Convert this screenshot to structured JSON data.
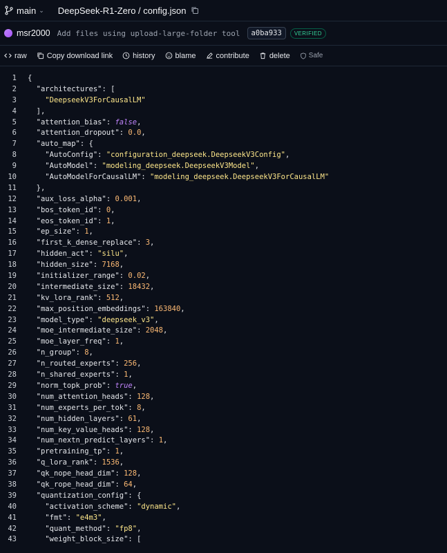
{
  "header": {
    "branch": "main",
    "path": "DeepSeek-R1-Zero / config.json"
  },
  "commit": {
    "author": "msr2000",
    "message": "Add files using upload-large-folder tool",
    "hash": "a0ba933",
    "badge": "VERIFIED"
  },
  "toolbar": {
    "raw": "raw",
    "copy": "Copy download link",
    "history": "history",
    "blame": "blame",
    "contribute": "contribute",
    "delete": "delete",
    "safe": "Safe"
  },
  "colors": {
    "string": "#fde68a",
    "number": "#fdba74",
    "boolean": "#c084fc",
    "verified": "#34d399"
  },
  "code_lines": [
    [
      [
        "p",
        "{"
      ]
    ],
    [
      [
        "p",
        "  "
      ],
      [
        "k",
        "\"architectures\""
      ],
      [
        "p",
        ": ["
      ]
    ],
    [
      [
        "p",
        "    "
      ],
      [
        "s",
        "\"DeepseekV3ForCausalLM\""
      ]
    ],
    [
      [
        "p",
        "  ],"
      ]
    ],
    [
      [
        "p",
        "  "
      ],
      [
        "k",
        "\"attention_bias\""
      ],
      [
        "p",
        ": "
      ],
      [
        "b",
        "false"
      ],
      [
        "p",
        ","
      ]
    ],
    [
      [
        "p",
        "  "
      ],
      [
        "k",
        "\"attention_dropout\""
      ],
      [
        "p",
        ": "
      ],
      [
        "n",
        "0.0"
      ],
      [
        "p",
        ","
      ]
    ],
    [
      [
        "p",
        "  "
      ],
      [
        "k",
        "\"auto_map\""
      ],
      [
        "p",
        ": {"
      ]
    ],
    [
      [
        "p",
        "    "
      ],
      [
        "k",
        "\"AutoConfig\""
      ],
      [
        "p",
        ": "
      ],
      [
        "s",
        "\"configuration_deepseek.DeepseekV3Config\""
      ],
      [
        "p",
        ","
      ]
    ],
    [
      [
        "p",
        "    "
      ],
      [
        "k",
        "\"AutoModel\""
      ],
      [
        "p",
        ": "
      ],
      [
        "s",
        "\"modeling_deepseek.DeepseekV3Model\""
      ],
      [
        "p",
        ","
      ]
    ],
    [
      [
        "p",
        "    "
      ],
      [
        "k",
        "\"AutoModelForCausalLM\""
      ],
      [
        "p",
        ": "
      ],
      [
        "s",
        "\"modeling_deepseek.DeepseekV3ForCausalLM\""
      ]
    ],
    [
      [
        "p",
        "  },"
      ]
    ],
    [
      [
        "p",
        "  "
      ],
      [
        "k",
        "\"aux_loss_alpha\""
      ],
      [
        "p",
        ": "
      ],
      [
        "n",
        "0.001"
      ],
      [
        "p",
        ","
      ]
    ],
    [
      [
        "p",
        "  "
      ],
      [
        "k",
        "\"bos_token_id\""
      ],
      [
        "p",
        ": "
      ],
      [
        "n",
        "0"
      ],
      [
        "p",
        ","
      ]
    ],
    [
      [
        "p",
        "  "
      ],
      [
        "k",
        "\"eos_token_id\""
      ],
      [
        "p",
        ": "
      ],
      [
        "n",
        "1"
      ],
      [
        "p",
        ","
      ]
    ],
    [
      [
        "p",
        "  "
      ],
      [
        "k",
        "\"ep_size\""
      ],
      [
        "p",
        ": "
      ],
      [
        "n",
        "1"
      ],
      [
        "p",
        ","
      ]
    ],
    [
      [
        "p",
        "  "
      ],
      [
        "k",
        "\"first_k_dense_replace\""
      ],
      [
        "p",
        ": "
      ],
      [
        "n",
        "3"
      ],
      [
        "p",
        ","
      ]
    ],
    [
      [
        "p",
        "  "
      ],
      [
        "k",
        "\"hidden_act\""
      ],
      [
        "p",
        ": "
      ],
      [
        "s",
        "\"silu\""
      ],
      [
        "p",
        ","
      ]
    ],
    [
      [
        "p",
        "  "
      ],
      [
        "k",
        "\"hidden_size\""
      ],
      [
        "p",
        ": "
      ],
      [
        "n",
        "7168"
      ],
      [
        "p",
        ","
      ]
    ],
    [
      [
        "p",
        "  "
      ],
      [
        "k",
        "\"initializer_range\""
      ],
      [
        "p",
        ": "
      ],
      [
        "n",
        "0.02"
      ],
      [
        "p",
        ","
      ]
    ],
    [
      [
        "p",
        "  "
      ],
      [
        "k",
        "\"intermediate_size\""
      ],
      [
        "p",
        ": "
      ],
      [
        "n",
        "18432"
      ],
      [
        "p",
        ","
      ]
    ],
    [
      [
        "p",
        "  "
      ],
      [
        "k",
        "\"kv_lora_rank\""
      ],
      [
        "p",
        ": "
      ],
      [
        "n",
        "512"
      ],
      [
        "p",
        ","
      ]
    ],
    [
      [
        "p",
        "  "
      ],
      [
        "k",
        "\"max_position_embeddings\""
      ],
      [
        "p",
        ": "
      ],
      [
        "n",
        "163840"
      ],
      [
        "p",
        ","
      ]
    ],
    [
      [
        "p",
        "  "
      ],
      [
        "k",
        "\"model_type\""
      ],
      [
        "p",
        ": "
      ],
      [
        "s",
        "\"deepseek_v3\""
      ],
      [
        "p",
        ","
      ]
    ],
    [
      [
        "p",
        "  "
      ],
      [
        "k",
        "\"moe_intermediate_size\""
      ],
      [
        "p",
        ": "
      ],
      [
        "n",
        "2048"
      ],
      [
        "p",
        ","
      ]
    ],
    [
      [
        "p",
        "  "
      ],
      [
        "k",
        "\"moe_layer_freq\""
      ],
      [
        "p",
        ": "
      ],
      [
        "n",
        "1"
      ],
      [
        "p",
        ","
      ]
    ],
    [
      [
        "p",
        "  "
      ],
      [
        "k",
        "\"n_group\""
      ],
      [
        "p",
        ": "
      ],
      [
        "n",
        "8"
      ],
      [
        "p",
        ","
      ]
    ],
    [
      [
        "p",
        "  "
      ],
      [
        "k",
        "\"n_routed_experts\""
      ],
      [
        "p",
        ": "
      ],
      [
        "n",
        "256"
      ],
      [
        "p",
        ","
      ]
    ],
    [
      [
        "p",
        "  "
      ],
      [
        "k",
        "\"n_shared_experts\""
      ],
      [
        "p",
        ": "
      ],
      [
        "n",
        "1"
      ],
      [
        "p",
        ","
      ]
    ],
    [
      [
        "p",
        "  "
      ],
      [
        "k",
        "\"norm_topk_prob\""
      ],
      [
        "p",
        ": "
      ],
      [
        "b",
        "true"
      ],
      [
        "p",
        ","
      ]
    ],
    [
      [
        "p",
        "  "
      ],
      [
        "k",
        "\"num_attention_heads\""
      ],
      [
        "p",
        ": "
      ],
      [
        "n",
        "128"
      ],
      [
        "p",
        ","
      ]
    ],
    [
      [
        "p",
        "  "
      ],
      [
        "k",
        "\"num_experts_per_tok\""
      ],
      [
        "p",
        ": "
      ],
      [
        "n",
        "8"
      ],
      [
        "p",
        ","
      ]
    ],
    [
      [
        "p",
        "  "
      ],
      [
        "k",
        "\"num_hidden_layers\""
      ],
      [
        "p",
        ": "
      ],
      [
        "n",
        "61"
      ],
      [
        "p",
        ","
      ]
    ],
    [
      [
        "p",
        "  "
      ],
      [
        "k",
        "\"num_key_value_heads\""
      ],
      [
        "p",
        ": "
      ],
      [
        "n",
        "128"
      ],
      [
        "p",
        ","
      ]
    ],
    [
      [
        "p",
        "  "
      ],
      [
        "k",
        "\"num_nextn_predict_layers\""
      ],
      [
        "p",
        ": "
      ],
      [
        "n",
        "1"
      ],
      [
        "p",
        ","
      ]
    ],
    [
      [
        "p",
        "  "
      ],
      [
        "k",
        "\"pretraining_tp\""
      ],
      [
        "p",
        ": "
      ],
      [
        "n",
        "1"
      ],
      [
        "p",
        ","
      ]
    ],
    [
      [
        "p",
        "  "
      ],
      [
        "k",
        "\"q_lora_rank\""
      ],
      [
        "p",
        ": "
      ],
      [
        "n",
        "1536"
      ],
      [
        "p",
        ","
      ]
    ],
    [
      [
        "p",
        "  "
      ],
      [
        "k",
        "\"qk_nope_head_dim\""
      ],
      [
        "p",
        ": "
      ],
      [
        "n",
        "128"
      ],
      [
        "p",
        ","
      ]
    ],
    [
      [
        "p",
        "  "
      ],
      [
        "k",
        "\"qk_rope_head_dim\""
      ],
      [
        "p",
        ": "
      ],
      [
        "n",
        "64"
      ],
      [
        "p",
        ","
      ]
    ],
    [
      [
        "p",
        "  "
      ],
      [
        "k",
        "\"quantization_config\""
      ],
      [
        "p",
        ": {"
      ]
    ],
    [
      [
        "p",
        "    "
      ],
      [
        "k",
        "\"activation_scheme\""
      ],
      [
        "p",
        ": "
      ],
      [
        "s",
        "\"dynamic\""
      ],
      [
        "p",
        ","
      ]
    ],
    [
      [
        "p",
        "    "
      ],
      [
        "k",
        "\"fmt\""
      ],
      [
        "p",
        ": "
      ],
      [
        "s",
        "\"e4m3\""
      ],
      [
        "p",
        ","
      ]
    ],
    [
      [
        "p",
        "    "
      ],
      [
        "k",
        "\"quant_method\""
      ],
      [
        "p",
        ": "
      ],
      [
        "s",
        "\"fp8\""
      ],
      [
        "p",
        ","
      ]
    ],
    [
      [
        "p",
        "    "
      ],
      [
        "k",
        "\"weight_block_size\""
      ],
      [
        "p",
        ": ["
      ]
    ]
  ]
}
